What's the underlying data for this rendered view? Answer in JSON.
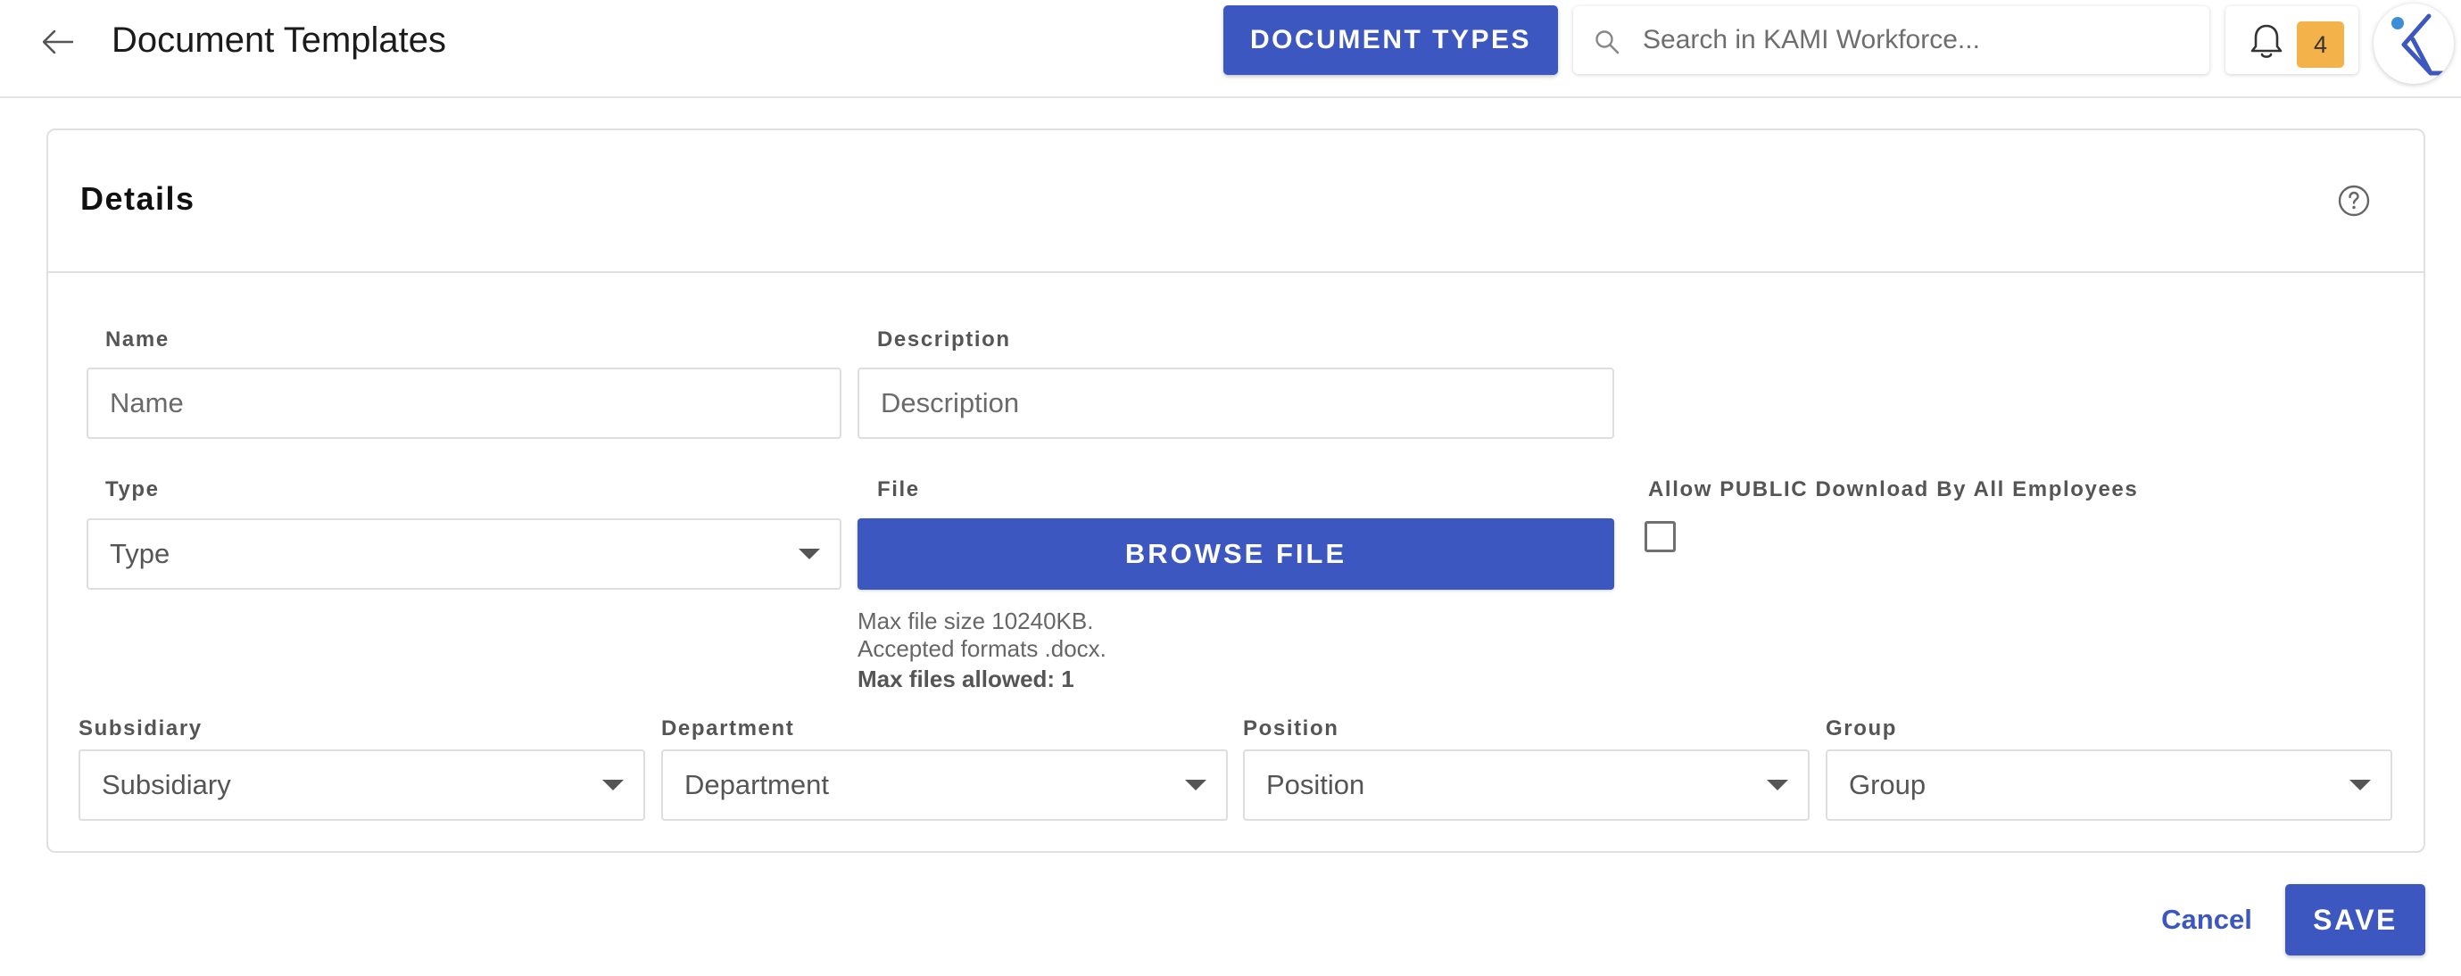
{
  "header": {
    "title": "Document Templates",
    "document_types_label": "DOCUMENT TYPES",
    "search_placeholder": "Search in KAMI Workforce...",
    "notification_count": "4"
  },
  "details": {
    "title": "Details",
    "fields": {
      "name": {
        "label": "Name",
        "placeholder": "Name"
      },
      "description": {
        "label": "Description",
        "placeholder": "Description"
      },
      "type": {
        "label": "Type",
        "value": "Type"
      },
      "file": {
        "label": "File",
        "browse_label": "BROWSE FILE",
        "max_size": "Max file size 10240KB.",
        "formats": "Accepted formats .docx.",
        "max_files": "Max files allowed: 1"
      },
      "public_download": {
        "label": "Allow PUBLIC Download By All Employees",
        "checked": false
      },
      "subsidiary": {
        "label": "Subsidiary",
        "value": "Subsidiary"
      },
      "department": {
        "label": "Department",
        "value": "Department"
      },
      "position": {
        "label": "Position",
        "value": "Position"
      },
      "group": {
        "label": "Group",
        "value": "Group"
      }
    }
  },
  "actions": {
    "cancel_label": "Cancel",
    "save_label": "SAVE"
  },
  "colors": {
    "primary": "#3d57c0",
    "badge": "#f4b24b",
    "border": "#e0e0e0"
  },
  "icons": [
    "arrow-left-icon",
    "search-icon",
    "bell-icon",
    "kami-logo-icon",
    "help-circle-icon",
    "caret-down-icon"
  ]
}
